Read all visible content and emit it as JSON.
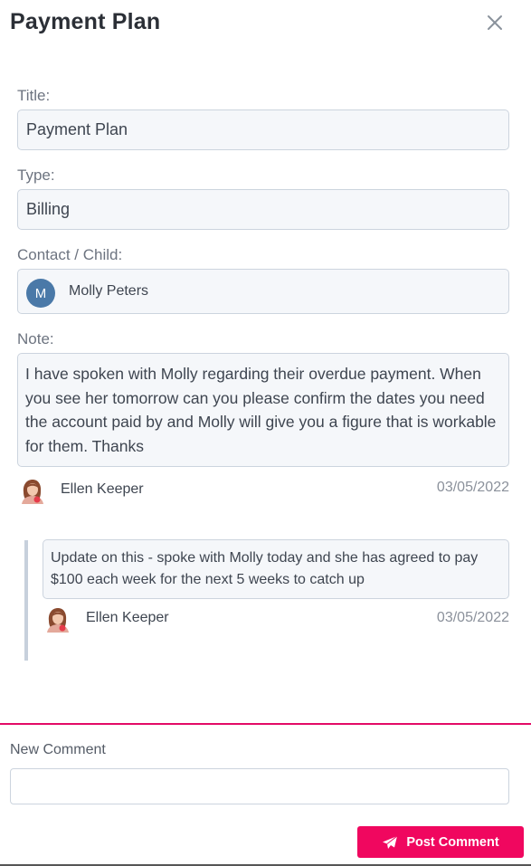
{
  "header": {
    "title": "Payment Plan"
  },
  "fields": {
    "title": {
      "label": "Title:",
      "value": "Payment Plan"
    },
    "type": {
      "label": "Type:",
      "value": "Billing"
    },
    "contact": {
      "label": "Contact / Child:",
      "initial": "M",
      "name": "Molly Peters"
    },
    "note": {
      "label": "Note:",
      "text": "I have spoken with Molly regarding their overdue payment. When you see her tomorrow can you please confirm the dates you need the account paid by and Molly will give you a figure that is workable for them. Thanks",
      "author": "Ellen Keeper",
      "date": "03/05/2022"
    }
  },
  "comments": [
    {
      "text": "Update on this - spoke with Molly today and she has agreed to pay $100 each week for the next 5 weeks to catch up",
      "author": "Ellen Keeper",
      "date": "03/05/2022"
    }
  ],
  "new_comment": {
    "label": "New Comment",
    "value": "",
    "placeholder": ""
  },
  "post_button": {
    "label": "Post Comment"
  },
  "colors": {
    "accent": "#f0075f",
    "divider": "#e30a66",
    "avatar": "#4a79a8"
  },
  "icons": {
    "close": "close-icon",
    "send": "paper-plane-icon",
    "author": "person-avatar-icon"
  }
}
